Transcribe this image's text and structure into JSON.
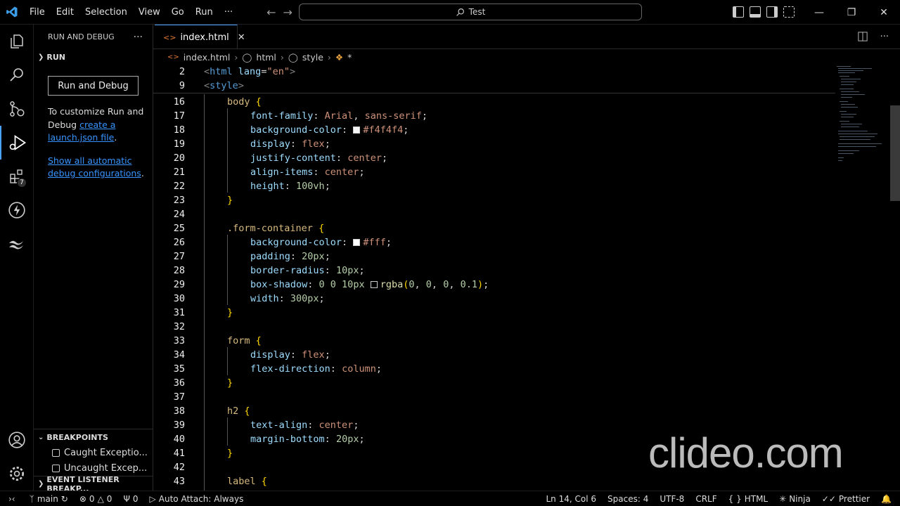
{
  "menu": [
    "File",
    "Edit",
    "Selection",
    "View",
    "Go",
    "Run",
    "···"
  ],
  "command_center": "Test",
  "sidebar": {
    "title": "RUN AND DEBUG",
    "more": "···",
    "section_run": "RUN",
    "run_button": "Run and Debug",
    "customize_text": "To customize Run and Debug ",
    "create_link": "create a launch.json file",
    "period": ".",
    "show_link": "Show all automatic debug configurations",
    "breakpoints_header": "BREAKPOINTS",
    "caught": "Caught Exceptio...",
    "uncaught": "Uncaught Excep...",
    "event_listener": "EVENT LISTENER BREAKP..."
  },
  "activity": {
    "extensions_badge": "7"
  },
  "tab": {
    "label": "index.html",
    "close": "✕"
  },
  "breadcrumb": {
    "file": "index.html",
    "html": "html",
    "style": "style",
    "star": "*"
  },
  "sticky": [
    {
      "num": "2",
      "text": "<html lang=\"en\">"
    },
    {
      "num": "9",
      "text": "<style>"
    }
  ],
  "code_lines": [
    {
      "num": "16",
      "text": "body {"
    },
    {
      "num": "17",
      "text": "font-family: Arial, sans-serif;"
    },
    {
      "num": "18",
      "text": "background-color: #f4f4f4;"
    },
    {
      "num": "19",
      "text": "display: flex;"
    },
    {
      "num": "20",
      "text": "justify-content: center;"
    },
    {
      "num": "21",
      "text": "align-items: center;"
    },
    {
      "num": "22",
      "text": "height: 100vh;"
    },
    {
      "num": "23",
      "text": "}"
    },
    {
      "num": "24",
      "text": ""
    },
    {
      "num": "25",
      "text": ".form-container {"
    },
    {
      "num": "26",
      "text": "background-color: #fff;"
    },
    {
      "num": "27",
      "text": "padding: 20px;"
    },
    {
      "num": "28",
      "text": "border-radius: 10px;"
    },
    {
      "num": "29",
      "text": "box-shadow: 0 0 10px rgba(0, 0, 0, 0.1);"
    },
    {
      "num": "30",
      "text": "width: 300px;"
    },
    {
      "num": "31",
      "text": "}"
    },
    {
      "num": "32",
      "text": ""
    },
    {
      "num": "33",
      "text": "form {"
    },
    {
      "num": "34",
      "text": "display: flex;"
    },
    {
      "num": "35",
      "text": "flex-direction: column;"
    },
    {
      "num": "36",
      "text": "}"
    },
    {
      "num": "37",
      "text": ""
    },
    {
      "num": "38",
      "text": "h2 {"
    },
    {
      "num": "39",
      "text": "text-align: center;"
    },
    {
      "num": "40",
      "text": "margin-bottom: 20px;"
    },
    {
      "num": "41",
      "text": "}"
    },
    {
      "num": "42",
      "text": ""
    },
    {
      "num": "43",
      "text": "label {"
    }
  ],
  "watermark": "clideo.com",
  "status": {
    "branch": "main",
    "errors": "0",
    "warnings": "0",
    "ports": "0",
    "auto_attach": "Auto Attach: Always",
    "position": "Ln 14, Col 6",
    "spaces": "Spaces: 4",
    "encoding": "UTF-8",
    "eol": "CRLF",
    "language": "HTML",
    "ninja": "Ninja",
    "prettier": "Prettier"
  },
  "colors": {
    "accent": "#4aa3ff",
    "link": "#3794ff",
    "background": "#000000"
  }
}
